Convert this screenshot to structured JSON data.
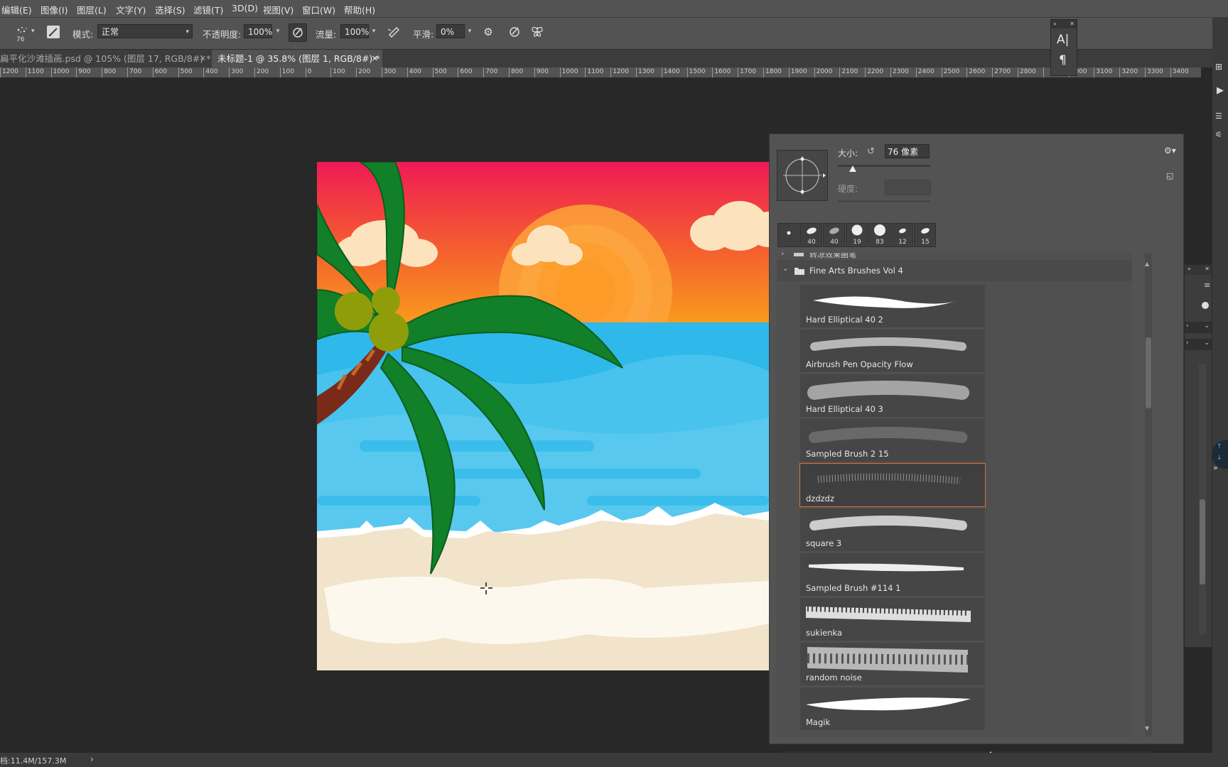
{
  "menu": {
    "items": [
      "编辑(E)",
      "图像(I)",
      "图层(L)",
      "文字(Y)",
      "选择(S)",
      "滤镜(T)",
      "3D(D)",
      "视图(V)",
      "窗口(W)",
      "帮助(H)"
    ]
  },
  "options": {
    "brush_size": "76",
    "mode_label": "模式:",
    "mode_value": "正常",
    "opacity_label": "不透明度:",
    "opacity_value": "100%",
    "flow_label": "流量:",
    "flow_value": "100%",
    "smooth_label": "平滑:",
    "smooth_value": "0%"
  },
  "tabs": [
    {
      "label": "扁平化沙滩插画.psd @ 105% (图层 17, RGB/8#) *",
      "active": false
    },
    {
      "label": "未标题-1 @ 35.8% (图层 1, RGB/8#) *",
      "active": true
    }
  ],
  "ruler": {
    "ticks": [
      "1200",
      "1100",
      "1000",
      "900",
      "800",
      "700",
      "600",
      "500",
      "400",
      "300",
      "200",
      "100",
      "0",
      "100",
      "200",
      "300",
      "400",
      "500",
      "600",
      "700",
      "800",
      "900",
      "1000",
      "1100",
      "1200",
      "1300",
      "1400",
      "1500",
      "1600",
      "1700",
      "1800",
      "1900",
      "2000",
      "2100",
      "2200",
      "2300",
      "2400",
      "2500",
      "2600",
      "2700",
      "2800",
      "",
      "3000",
      "3100",
      "3200",
      "3300",
      "3400"
    ]
  },
  "brush_panel": {
    "size_label": "大小:",
    "size_value": "76 像素",
    "hardness_label": "硬度:",
    "size_slider_fraction": 0.16,
    "recent_brushes": [
      "",
      "40",
      "40",
      "19",
      "83",
      "12",
      "15"
    ],
    "partial_group_label": "转凉效果画笔",
    "group_label": "Fine Arts Brushes Vol 4",
    "brushes": [
      {
        "name": "Hard Elliptical 40 2"
      },
      {
        "name": "Airbrush Pen Opacity Flow"
      },
      {
        "name": "Hard Elliptical 40 3"
      },
      {
        "name": "Sampled Brush 2 15"
      },
      {
        "name": "dzdzdz",
        "selected": true
      },
      {
        "name": "square 3"
      },
      {
        "name": "Sampled Brush #114 1"
      },
      {
        "name": "sukienka"
      },
      {
        "name": "random noise"
      },
      {
        "name": "Magik"
      }
    ]
  },
  "float_panel": {
    "text_icon": "A|",
    "para_icon": "¶"
  },
  "status": {
    "doc_size": "档:11.4M/157.3M",
    "arrow": "›"
  },
  "colors": {
    "panel": "#535353",
    "selection_outline": "#e0703a",
    "sky_top": "#ef1a55",
    "sea": "#58c8ef",
    "sand": "#f1e4ca",
    "palm_green": "#118029"
  }
}
